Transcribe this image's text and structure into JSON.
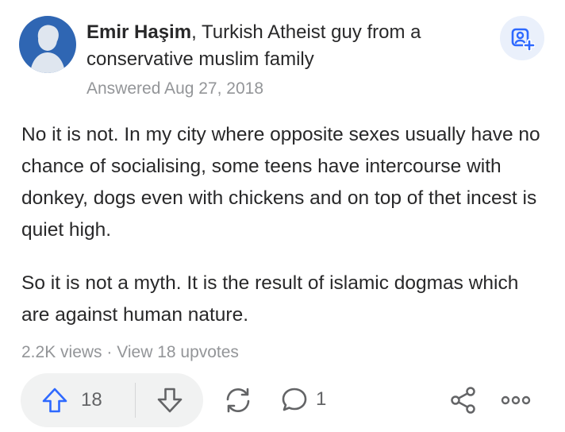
{
  "author": {
    "name": "Emir Haşim",
    "credential": ", Turkish Atheist guy from a conservative muslim family",
    "answered": "Answered Aug 27, 2018"
  },
  "answer": {
    "paragraphs": [
      "No it is not. In my city where opposite sexes usually have no chance of socialising, some teens have intercourse with donkey, dogs even with chickens and on top of thet incest is quiet high.",
      "So it is not a myth. It is the result of islamic dogmas which are against human nature."
    ]
  },
  "stats": {
    "views": "2.2K views",
    "separator": " · ",
    "upvotes_link": "View 18 upvotes"
  },
  "actions": {
    "upvote_count": "18",
    "comment_count": "1"
  },
  "colors": {
    "accent": "#2e69ff",
    "avatar_bg": "#2f66b3",
    "muted_text": "#939598",
    "icon_gray": "#636466"
  },
  "icons": {
    "follow": "add-person-icon",
    "upvote": "arrow-up-icon",
    "downvote": "arrow-down-icon",
    "reshare": "reshare-icon",
    "comment": "comment-bubble-icon",
    "share": "share-icon",
    "more": "more-dots-icon"
  }
}
